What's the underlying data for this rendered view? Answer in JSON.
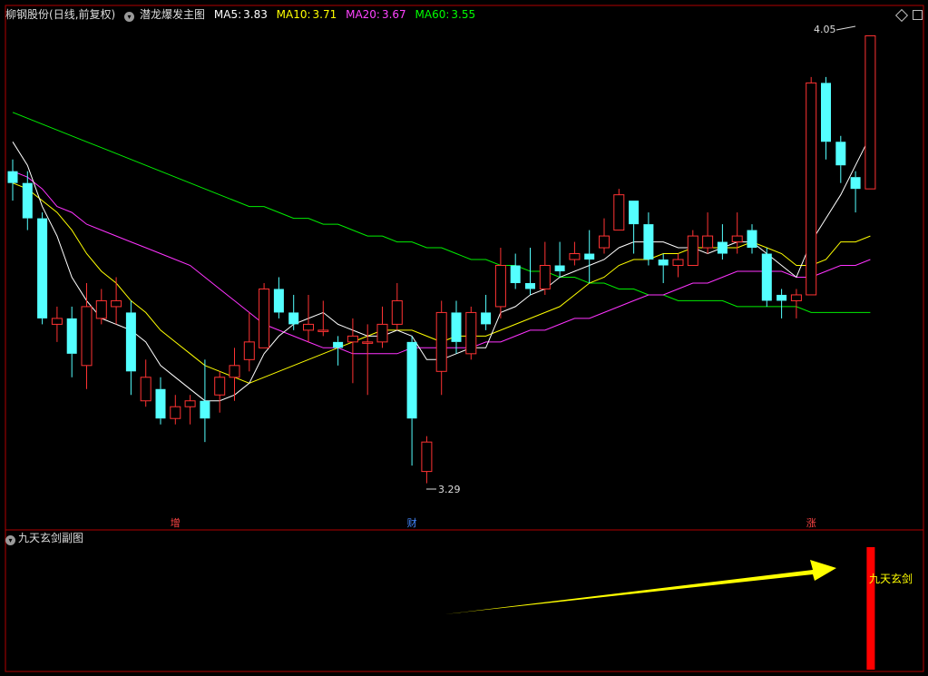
{
  "header": {
    "stock_name": "柳钢股份",
    "period_label": "(日线,前复权)",
    "indicator_name": "潜龙爆发主图",
    "ma_items": [
      {
        "label": "MA5:",
        "value": "3.83",
        "color": "#ffffff"
      },
      {
        "label": "MA10:",
        "value": "3.71",
        "color": "#ffff00"
      },
      {
        "label": "MA20:",
        "value": "3.67",
        "color": "#ff44ff"
      },
      {
        "label": "MA60:",
        "value": "3.55",
        "color": "#00ff00"
      }
    ]
  },
  "sub_panel": {
    "title": "九天玄剑副图",
    "signal_label": "九天玄剑"
  },
  "markers": [
    {
      "text": "增",
      "index": 11,
      "color": "#ff4444"
    },
    {
      "text": "财",
      "index": 27,
      "color": "#4488ff"
    },
    {
      "text": "涨",
      "index": 54,
      "color": "#ff4444"
    }
  ],
  "annotations": {
    "max_label": "4.05",
    "min_label": "3.29"
  },
  "colors": {
    "up": "#ff3333",
    "down": "#54ffff",
    "ma5": "#ffffff",
    "ma10": "#ffff00",
    "ma20": "#ff33ff",
    "ma60": "#00ee00",
    "frame": "#b00000",
    "arrow": "#ffff00",
    "signal": "#ff0000"
  },
  "chart_data": {
    "type": "candlestick",
    "ylim": [
      3.22,
      4.08
    ],
    "candles": [
      [
        3.82,
        3.8,
        3.84,
        3.77
      ],
      [
        3.8,
        3.74,
        3.82,
        3.72
      ],
      [
        3.74,
        3.57,
        3.75,
        3.56
      ],
      [
        3.56,
        3.57,
        3.59,
        3.53
      ],
      [
        3.57,
        3.51,
        3.59,
        3.47
      ],
      [
        3.49,
        3.59,
        3.63,
        3.45
      ],
      [
        3.57,
        3.6,
        3.62,
        3.56
      ],
      [
        3.59,
        3.6,
        3.64,
        3.56
      ],
      [
        3.58,
        3.48,
        3.6,
        3.44
      ],
      [
        3.43,
        3.47,
        3.5,
        3.42
      ],
      [
        3.45,
        3.4,
        3.47,
        3.39
      ],
      [
        3.4,
        3.42,
        3.44,
        3.39
      ],
      [
        3.42,
        3.43,
        3.44,
        3.39
      ],
      [
        3.43,
        3.4,
        3.5,
        3.36
      ],
      [
        3.44,
        3.47,
        3.48,
        3.41
      ],
      [
        3.47,
        3.49,
        3.52,
        3.43
      ],
      [
        3.5,
        3.53,
        3.58,
        3.48
      ],
      [
        3.52,
        3.62,
        3.63,
        3.52
      ],
      [
        3.62,
        3.58,
        3.64,
        3.57
      ],
      [
        3.58,
        3.56,
        3.61,
        3.55
      ],
      [
        3.55,
        3.56,
        3.61,
        3.53
      ],
      [
        3.55,
        3.55,
        3.6,
        3.54
      ],
      [
        3.53,
        3.52,
        3.54,
        3.49
      ],
      [
        3.53,
        3.54,
        3.57,
        3.46
      ],
      [
        3.53,
        3.53,
        3.56,
        3.44
      ],
      [
        3.53,
        3.56,
        3.59,
        3.52
      ],
      [
        3.56,
        3.6,
        3.63,
        3.55
      ],
      [
        3.53,
        3.4,
        3.54,
        3.32
      ],
      [
        3.31,
        3.36,
        3.37,
        3.29
      ],
      [
        3.48,
        3.58,
        3.6,
        3.44
      ],
      [
        3.58,
        3.53,
        3.6,
        3.51
      ],
      [
        3.51,
        3.58,
        3.59,
        3.5
      ],
      [
        3.58,
        3.56,
        3.61,
        3.55
      ],
      [
        3.59,
        3.66,
        3.69,
        3.57
      ],
      [
        3.66,
        3.63,
        3.68,
        3.62
      ],
      [
        3.63,
        3.62,
        3.69,
        3.61
      ],
      [
        3.62,
        3.66,
        3.7,
        3.61
      ],
      [
        3.66,
        3.65,
        3.7,
        3.64
      ],
      [
        3.67,
        3.68,
        3.7,
        3.66
      ],
      [
        3.68,
        3.67,
        3.72,
        3.63
      ],
      [
        3.69,
        3.71,
        3.74,
        3.68
      ],
      [
        3.72,
        3.78,
        3.79,
        3.72
      ],
      [
        3.77,
        3.73,
        3.77,
        3.68
      ],
      [
        3.73,
        3.67,
        3.75,
        3.66
      ],
      [
        3.67,
        3.66,
        3.68,
        3.63
      ],
      [
        3.66,
        3.67,
        3.68,
        3.64
      ],
      [
        3.66,
        3.71,
        3.72,
        3.66
      ],
      [
        3.69,
        3.71,
        3.75,
        3.68
      ],
      [
        3.7,
        3.68,
        3.73,
        3.67
      ],
      [
        3.7,
        3.71,
        3.75,
        3.68
      ],
      [
        3.72,
        3.69,
        3.73,
        3.68
      ],
      [
        3.68,
        3.6,
        3.69,
        3.59
      ],
      [
        3.61,
        3.6,
        3.62,
        3.57
      ],
      [
        3.6,
        3.61,
        3.62,
        3.57
      ],
      [
        3.61,
        3.97,
        3.98,
        3.61
      ],
      [
        3.97,
        3.87,
        3.98,
        3.84
      ],
      [
        3.87,
        3.83,
        3.88,
        3.8
      ],
      [
        3.81,
        3.79,
        3.82,
        3.75
      ],
      [
        3.79,
        4.05,
        4.05,
        3.79
      ]
    ],
    "ma5": [
      3.87,
      3.83,
      3.76,
      3.71,
      3.64,
      3.6,
      3.57,
      3.56,
      3.55,
      3.53,
      3.49,
      3.47,
      3.45,
      3.43,
      3.43,
      3.44,
      3.46,
      3.51,
      3.54,
      3.56,
      3.57,
      3.58,
      3.56,
      3.55,
      3.54,
      3.54,
      3.55,
      3.54,
      3.5,
      3.5,
      3.51,
      3.52,
      3.52,
      3.58,
      3.59,
      3.61,
      3.62,
      3.64,
      3.65,
      3.66,
      3.67,
      3.69,
      3.7,
      3.7,
      3.7,
      3.69,
      3.69,
      3.68,
      3.69,
      3.7,
      3.7,
      3.68,
      3.66,
      3.64,
      3.7,
      3.74,
      3.78,
      3.83,
      3.88
    ],
    "ma10": [
      3.8,
      3.79,
      3.77,
      3.75,
      3.72,
      3.68,
      3.65,
      3.63,
      3.6,
      3.58,
      3.55,
      3.53,
      3.51,
      3.49,
      3.48,
      3.47,
      3.46,
      3.47,
      3.48,
      3.49,
      3.5,
      3.51,
      3.52,
      3.53,
      3.54,
      3.55,
      3.55,
      3.55,
      3.54,
      3.53,
      3.54,
      3.54,
      3.54,
      3.55,
      3.56,
      3.57,
      3.58,
      3.59,
      3.61,
      3.63,
      3.64,
      3.66,
      3.67,
      3.67,
      3.68,
      3.68,
      3.69,
      3.69,
      3.69,
      3.69,
      3.7,
      3.69,
      3.68,
      3.66,
      3.66,
      3.67,
      3.7,
      3.7,
      3.71
    ],
    "ma20": [
      3.82,
      3.81,
      3.79,
      3.76,
      3.75,
      3.73,
      3.72,
      3.71,
      3.7,
      3.69,
      3.68,
      3.67,
      3.66,
      3.64,
      3.62,
      3.6,
      3.58,
      3.56,
      3.55,
      3.54,
      3.53,
      3.52,
      3.52,
      3.51,
      3.51,
      3.51,
      3.51,
      3.52,
      3.52,
      3.52,
      3.52,
      3.52,
      3.53,
      3.53,
      3.54,
      3.55,
      3.55,
      3.56,
      3.57,
      3.57,
      3.58,
      3.59,
      3.6,
      3.61,
      3.61,
      3.62,
      3.63,
      3.63,
      3.64,
      3.65,
      3.65,
      3.65,
      3.65,
      3.64,
      3.64,
      3.65,
      3.66,
      3.66,
      3.67
    ],
    "ma60": [
      3.92,
      3.91,
      3.9,
      3.89,
      3.88,
      3.87,
      3.86,
      3.85,
      3.84,
      3.83,
      3.82,
      3.81,
      3.8,
      3.79,
      3.78,
      3.77,
      3.76,
      3.76,
      3.75,
      3.74,
      3.74,
      3.73,
      3.73,
      3.72,
      3.71,
      3.71,
      3.7,
      3.7,
      3.69,
      3.69,
      3.68,
      3.67,
      3.67,
      3.66,
      3.66,
      3.65,
      3.65,
      3.64,
      3.64,
      3.63,
      3.63,
      3.62,
      3.62,
      3.61,
      3.61,
      3.6,
      3.6,
      3.6,
      3.6,
      3.59,
      3.59,
      3.59,
      3.59,
      3.59,
      3.58,
      3.58,
      3.58,
      3.58,
      3.58
    ],
    "signal_index": 58
  }
}
